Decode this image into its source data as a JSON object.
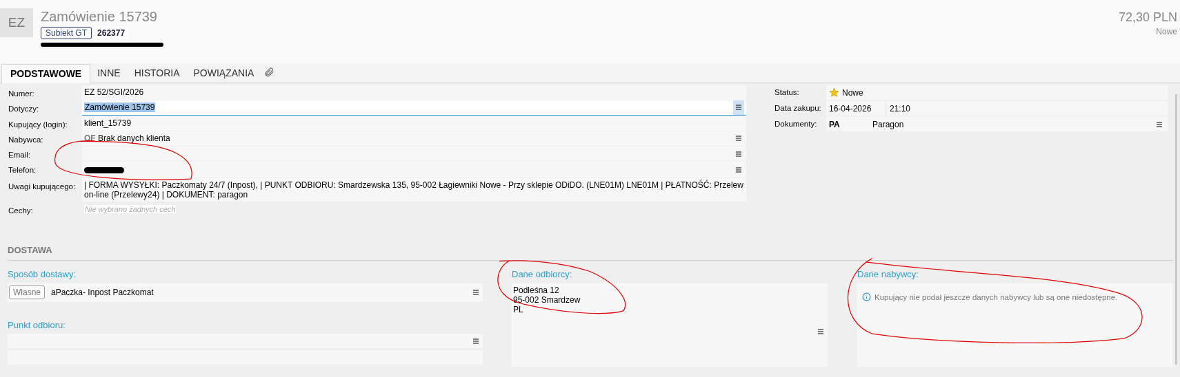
{
  "header": {
    "badge": "EZ",
    "title": "Zamówienie 15739",
    "tags": [
      {
        "text": "Subiekt GT",
        "kind": "outlined"
      },
      {
        "text": "262377",
        "kind": "bold"
      }
    ],
    "amount": "72,30 PLN",
    "status": "Nowe"
  },
  "tabs": [
    {
      "label": "PODSTAWOWE",
      "selected": true
    },
    {
      "label": "INNE",
      "selected": false
    },
    {
      "label": "HISTORIA",
      "selected": false
    },
    {
      "label": "POWIĄZANIA",
      "selected": false
    }
  ],
  "left_fields": [
    {
      "label": "Numer:",
      "kind": "text",
      "value": "EZ 52/SGI/2026",
      "menu": false
    },
    {
      "label": "Dotyczy:",
      "kind": "focused",
      "value": "Zamówienie 15739",
      "menu": true
    },
    {
      "label": "Kupujący (login):",
      "kind": "text",
      "value": "klient_15739",
      "menu": false
    },
    {
      "label": "Nabywca:",
      "kind": "code",
      "code": "OF",
      "value": "Brak danych klienta",
      "menu": true
    },
    {
      "label": "Email:",
      "kind": "text",
      "menu": true
    },
    {
      "label": "Telefon:",
      "kind": "redacted",
      "menu": true
    },
    {
      "label": "Uwagi kupującego:",
      "kind": "text",
      "value": "| FORMA WYSYŁKI: Paczkomaty 24/7 (Inpost),  | PUNKT ODBIORU: Smardzewska 135, 95-002 Łagiewniki Nowe - Przy sklepie ODiDO.  (LNE01M)  LNE01M  | PŁATNOŚĆ: Przelew on-line (Przelewy24) | DOKUMENT: paragon",
      "menu": false
    },
    {
      "label": "Cechy:",
      "kind": "placeholder",
      "placeholder": "Nie wybrano żadnych cech",
      "menu": false
    }
  ],
  "right_fields": [
    {
      "label": "Status:",
      "kind": "status",
      "value": "Nowe"
    },
    {
      "label": "Data zakupu:",
      "kind": "split",
      "values": [
        "16-04-2026",
        "21:10"
      ]
    },
    {
      "label": "Dokumenty:",
      "kind": "document",
      "code": "PA",
      "value": "Paragon"
    }
  ],
  "delivery": {
    "title": "DOSTAWA",
    "method": {
      "label": "Sposób dostawy:",
      "tag": "Własne",
      "value": "aPaczka- Inpost Paczkomat"
    },
    "pickup": {
      "label": "Punkt odbioru:"
    },
    "recipient": {
      "label": "Dane odbiorcy:",
      "lines": [
        "Podleśna 12",
        "95-002 Smardzew",
        "PL"
      ]
    },
    "buyer": {
      "label": "Dane nabywcy:",
      "info": "Kupujący nie podał jeszcze danych nabywcy lub są one niedostępne."
    }
  }
}
